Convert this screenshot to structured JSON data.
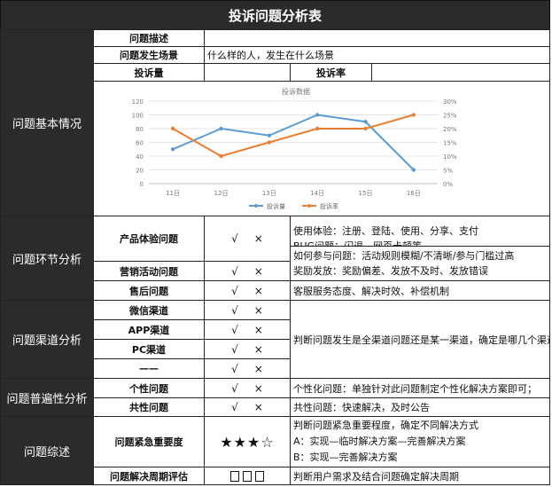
{
  "title": "投诉问题分析表",
  "sections": {
    "basic": "问题基本情况",
    "stage": "问题环节分析",
    "channel": "问题渠道分析",
    "generality": "问题普遍性分析",
    "summary": "问题综述"
  },
  "basic": {
    "desc_label": "问题描述",
    "desc_value": "",
    "scene_label": "问题发生场景",
    "scene_value": "什么样的人，发生在什么场景",
    "volume_label": "投诉量",
    "volume_value": "",
    "rate_label": "投诉率",
    "rate_value": ""
  },
  "marks": {
    "yes": "√",
    "no": "×"
  },
  "stage": {
    "rows": [
      {
        "label": "产品体验问题",
        "notes": [
          "使用体验：注册、登陆、使用、分享、支付",
          "BUG问题：闪退、网页卡顿等"
        ]
      },
      {
        "label": "营销活动问题",
        "notes": [
          "如何参与问题：活动规则模糊/不清晰/参与门槛过高",
          "奖励发放：奖励偏差、发放不及时、发放错误"
        ]
      },
      {
        "label": "售后问题",
        "notes": [
          "客服服务态度、解决时效、补偿机制"
        ]
      }
    ]
  },
  "channel": {
    "rows": [
      {
        "label": "微信渠道"
      },
      {
        "label": "APP渠道"
      },
      {
        "label": "PC渠道"
      },
      {
        "label": "——"
      }
    ],
    "note": "判断问题发生是全渠道问题还是某一渠道，确定是哪几个渠道"
  },
  "generality": {
    "rows": [
      {
        "label": "个性问题",
        "note": "个性化问题：单独针对此问题制定个性化解决方案即可；"
      },
      {
        "label": "共性问题",
        "note": "共性问题：快速解决，及时公告"
      }
    ]
  },
  "summary": {
    "urgency_label": "问题紧急重要度",
    "urgency_stars": "★★★☆",
    "urgency_notes": [
      "判断问题紧急重要程度，确定不同解决方式",
      "A：实现—临时解决方案—完善解决方案",
      "B：实现—完善解决方案"
    ],
    "cycle_label": "问题解决周期评估",
    "cycle_note": "判断用户需求及结合问题确定解决周期"
  },
  "chart_data": {
    "type": "line",
    "title": "投诉数据",
    "categories": [
      "11日",
      "12日",
      "13日",
      "14日",
      "15日",
      "16日"
    ],
    "series": [
      {
        "name": "投诉量",
        "axis": "left",
        "color": "#5b9bd5",
        "values": [
          50,
          80,
          70,
          100,
          90,
          20
        ]
      },
      {
        "name": "投诉率",
        "axis": "right",
        "color": "#ed7d31",
        "values": [
          20,
          10,
          15,
          20,
          20,
          25
        ]
      }
    ],
    "y_left": {
      "min": 0,
      "max": 120,
      "ticks": [
        "0",
        "20",
        "40",
        "60",
        "80",
        "100",
        "120"
      ]
    },
    "y_right": {
      "min": 0,
      "max": 30,
      "ticks": [
        "0%",
        "5%",
        "10%",
        "15%",
        "20%",
        "25%",
        "30%"
      ]
    },
    "legend": "bottom",
    "grid": true
  }
}
